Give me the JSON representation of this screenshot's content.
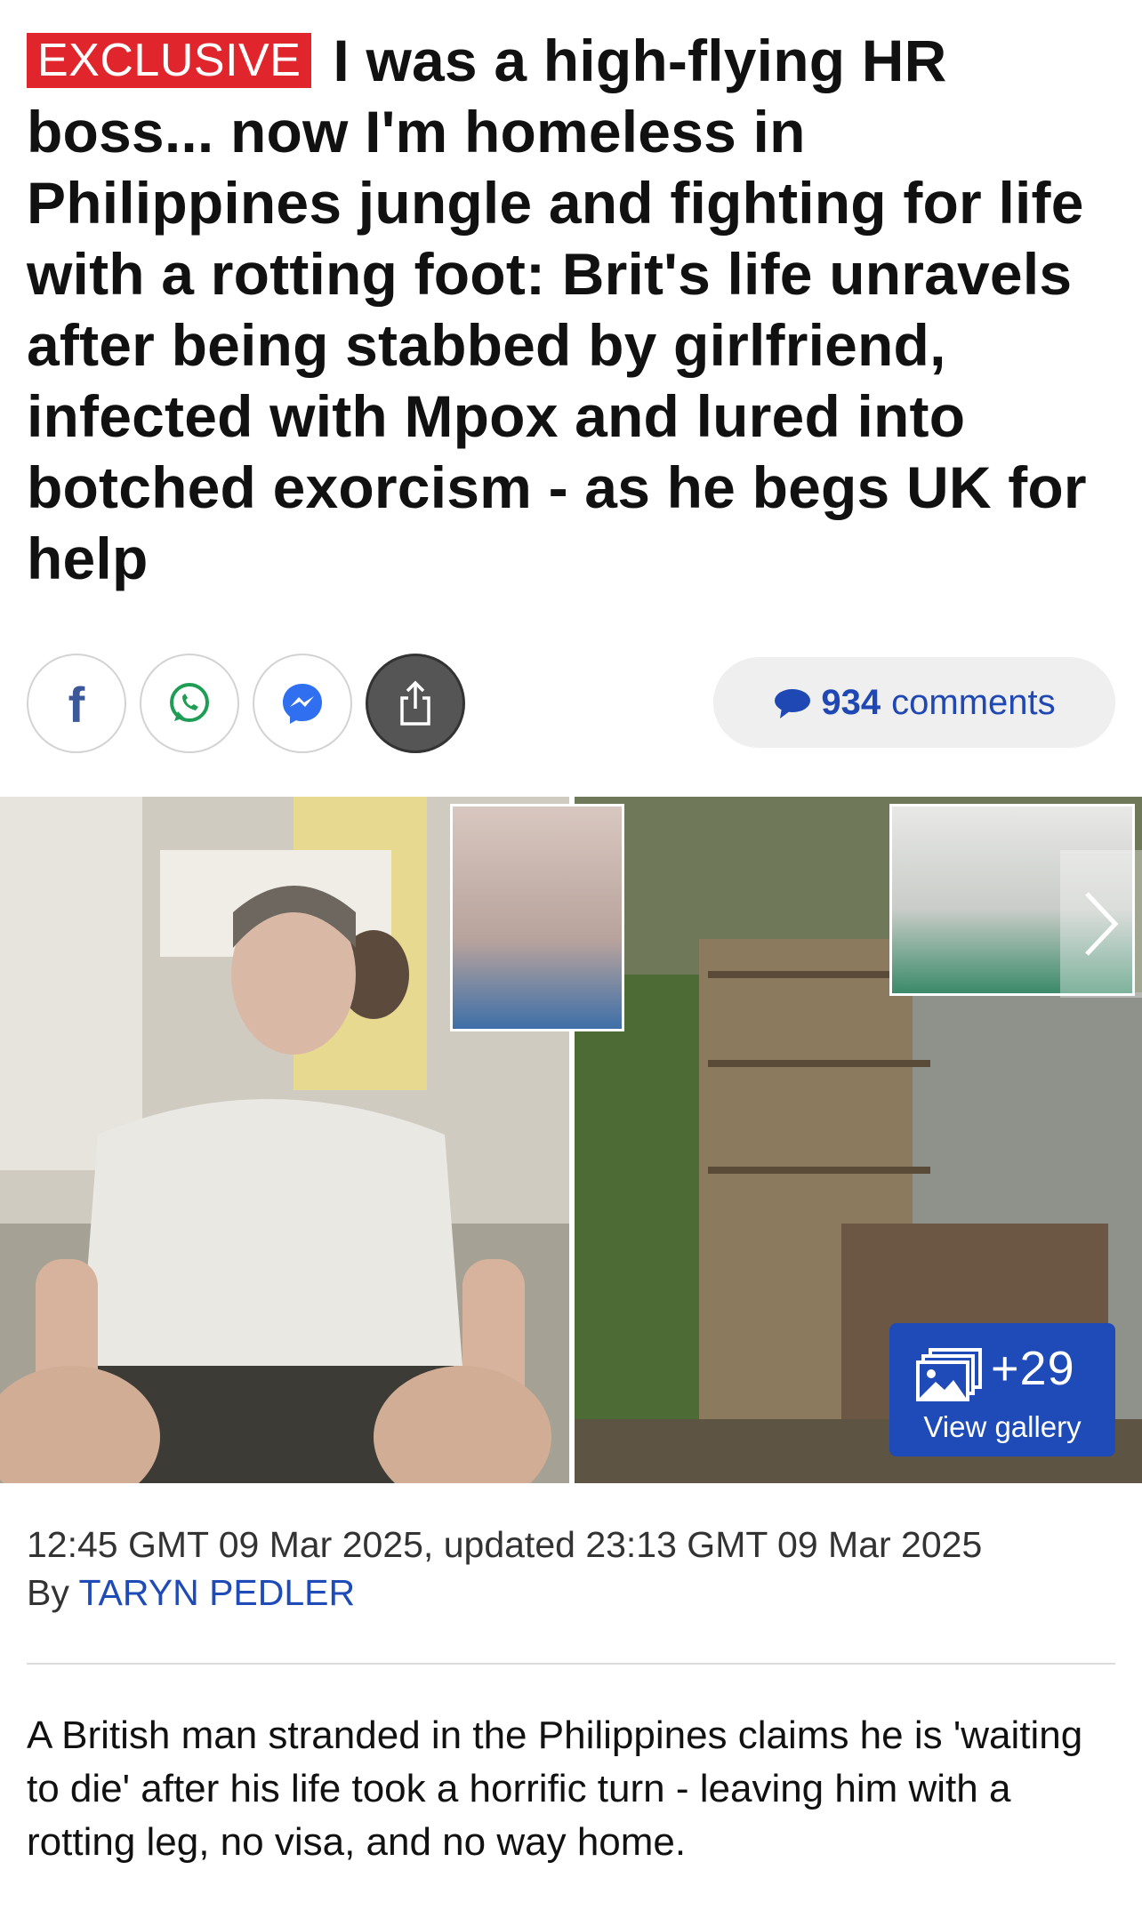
{
  "article": {
    "badge": "EXCLUSIVE",
    "headline": "I was a high-flying HR boss... now I'm homeless in Philippines jungle and fighting for life with a rotting foot: Brit's life unravels after being stabbed by girlfriend, infected with Mpox and lured into botched exorcism - as he begs UK for help",
    "timestamp": "12:45 GMT 09 Mar 2025, updated 23:13 GMT 09 Mar 2025",
    "by_label": "By",
    "author": "TARYN PEDLER",
    "intro": " A British man stranded in the Philippines claims he is 'waiting to die' after his life took a horrific turn - leaving him with a rotting leg, no visa, and no way home."
  },
  "share": {
    "facebook_icon": "facebook-icon",
    "whatsapp_icon": "whatsapp-icon",
    "messenger_icon": "messenger-icon",
    "share_icon": "share-icon"
  },
  "comments": {
    "count": "934",
    "word": "comments"
  },
  "gallery": {
    "plus_count": "+29",
    "label": "View gallery"
  },
  "colors": {
    "badge_red": "#e0262c",
    "link_blue": "#1e4bb8",
    "comment_blue": "#1f48b5"
  }
}
